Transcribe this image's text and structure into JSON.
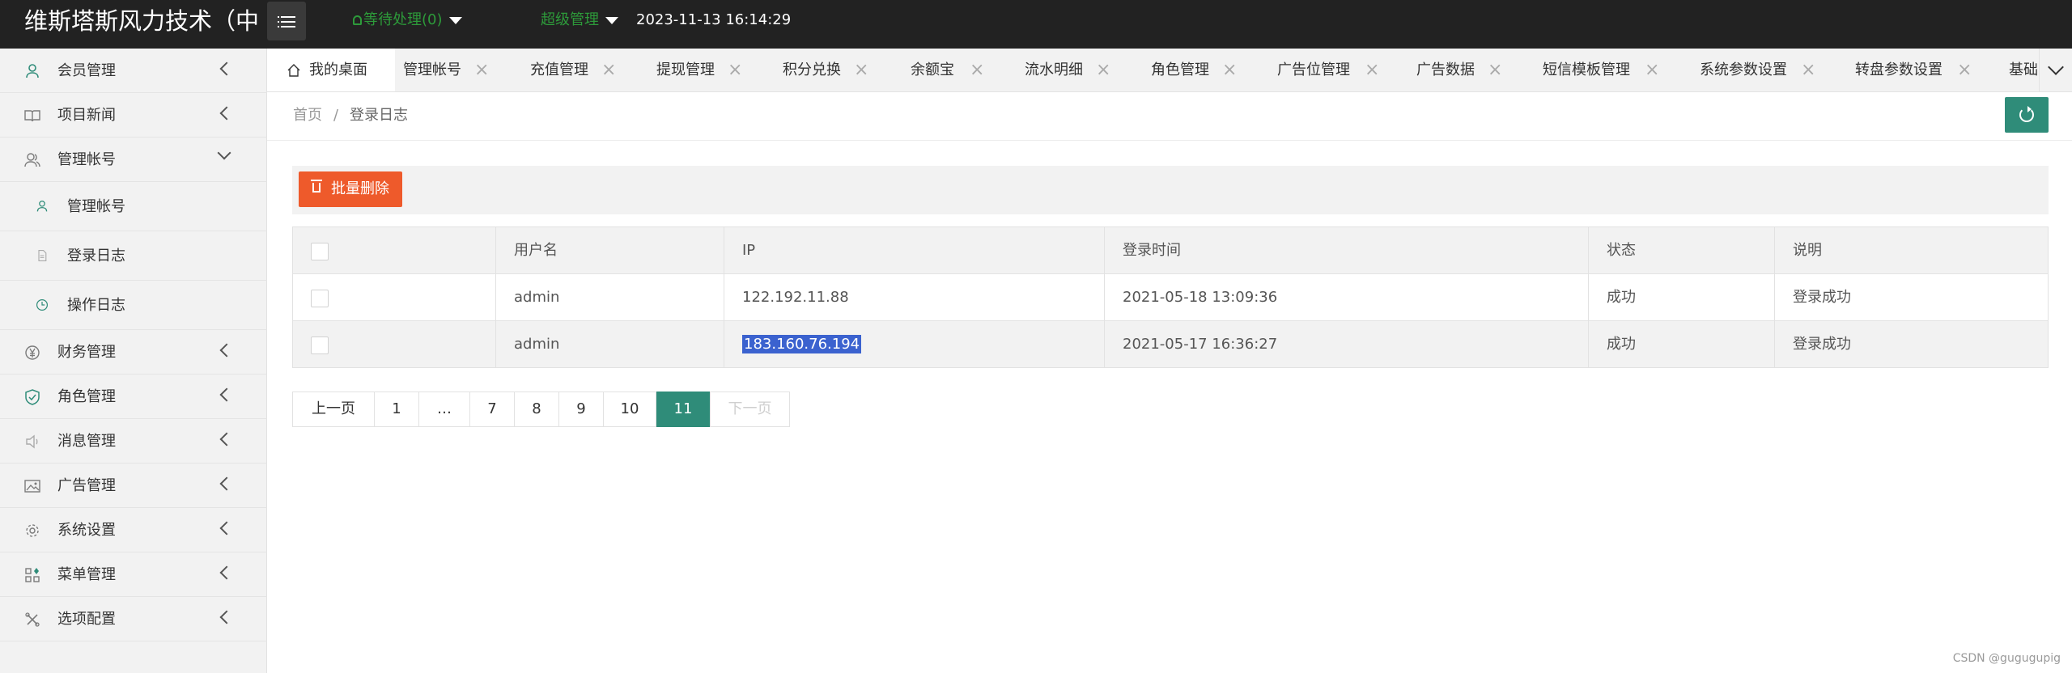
{
  "header": {
    "logo": "维斯塔斯风力技术（中",
    "pending": "等待处理(0)",
    "admin": "超级管理",
    "datetime": "2023-11-13 16:14:29"
  },
  "sidebar": {
    "items": [
      {
        "label": "会员管理",
        "icon": "user-icon"
      },
      {
        "label": "项目新闻",
        "icon": "book-icon"
      },
      {
        "label": "管理帐号",
        "icon": "users-icon",
        "expanded": true
      },
      {
        "label": "财务管理",
        "icon": "yen-icon"
      },
      {
        "label": "角色管理",
        "icon": "shield-icon"
      },
      {
        "label": "消息管理",
        "icon": "speaker-icon"
      },
      {
        "label": "广告管理",
        "icon": "image-icon"
      },
      {
        "label": "系统设置",
        "icon": "gear-icon"
      },
      {
        "label": "菜单管理",
        "icon": "grid-icon"
      },
      {
        "label": "选项配置",
        "icon": "tools-icon"
      }
    ],
    "subitems": [
      {
        "label": "管理帐号",
        "icon": "user-icon"
      },
      {
        "label": "登录日志",
        "icon": "file-icon"
      },
      {
        "label": "操作日志",
        "icon": "clock-icon"
      }
    ]
  },
  "tabs": [
    {
      "label": "我的桌面"
    },
    {
      "label": "管理帐号"
    },
    {
      "label": "充值管理"
    },
    {
      "label": "提现管理"
    },
    {
      "label": "积分兑换"
    },
    {
      "label": "余额宝"
    },
    {
      "label": "流水明细"
    },
    {
      "label": "角色管理"
    },
    {
      "label": "广告位管理"
    },
    {
      "label": "广告数据"
    },
    {
      "label": "短信模板管理"
    },
    {
      "label": "系统参数设置"
    },
    {
      "label": "转盘参数设置"
    },
    {
      "label": "基础"
    }
  ],
  "breadcrumb": {
    "home": "首页",
    "separator": "/",
    "current": "登录日志"
  },
  "toolbar": {
    "batch_delete": "批量删除"
  },
  "table": {
    "headers": [
      "用户名",
      "IP",
      "登录时间",
      "状态",
      "说明"
    ],
    "rows": [
      [
        "admin",
        "122.192.11.88",
        "2021-05-18 13:09:36",
        "成功",
        "登录成功"
      ],
      [
        "admin",
        "183.160.76.194",
        "2021-05-17 16:36:27",
        "成功",
        "登录成功"
      ]
    ]
  },
  "pagination": {
    "prev": "上一页",
    "pages": [
      "1",
      "…",
      "7",
      "8",
      "9",
      "10",
      "11"
    ],
    "current": "11",
    "next": "下一页"
  },
  "watermark": "CSDN @gugugupig",
  "colors": {
    "accent": "#2f8c79",
    "danger": "#ee5a2b",
    "topbar": "#222222",
    "pending": "#2d9a3a"
  }
}
